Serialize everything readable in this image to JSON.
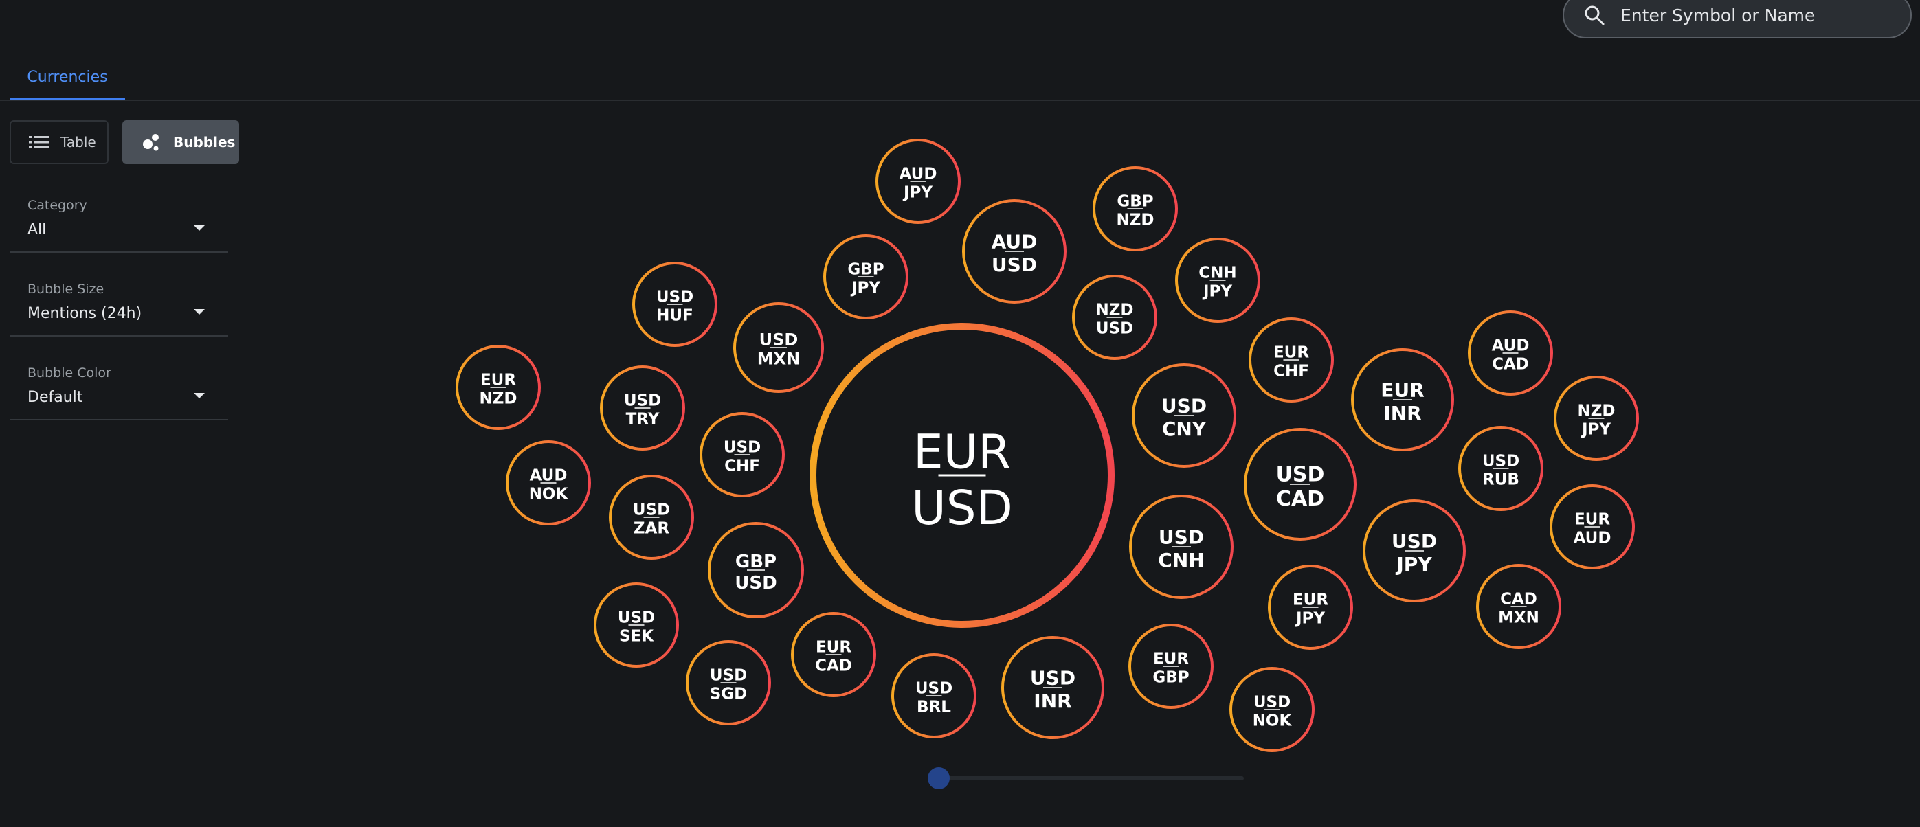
{
  "search": {
    "placeholder": "Enter Symbol or Name"
  },
  "tabs": [
    {
      "label": "Currencies",
      "active": true
    }
  ],
  "view_toggle": {
    "table_label": "Table",
    "bubbles_label": "Bubbles",
    "active": "Bubbles"
  },
  "filters": {
    "category": {
      "label": "Category",
      "value": "All"
    },
    "bubble_size": {
      "label": "Bubble Size",
      "value": "Mentions (24h)"
    },
    "bubble_color": {
      "label": "Bubble Color",
      "value": "Default"
    }
  },
  "colors": {
    "accent": "#4f8ff7",
    "bubble_gradient_start": "#f5a623",
    "bubble_gradient_end": "#f2464e",
    "background": "#16181b"
  },
  "chart_data": {
    "type": "bubble",
    "size_metric": "Mentions (24h)",
    "bubbles": [
      {
        "base": "EUR",
        "quote": "USD"
      },
      {
        "base": "AUD",
        "quote": "JPY"
      },
      {
        "base": "AUD",
        "quote": "USD"
      },
      {
        "base": "GBP",
        "quote": "NZD"
      },
      {
        "base": "GBP",
        "quote": "JPY"
      },
      {
        "base": "CNH",
        "quote": "JPY"
      },
      {
        "base": "NZD",
        "quote": "USD"
      },
      {
        "base": "USD",
        "quote": "HUF"
      },
      {
        "base": "USD",
        "quote": "MXN"
      },
      {
        "base": "EUR",
        "quote": "CHF"
      },
      {
        "base": "AUD",
        "quote": "CAD"
      },
      {
        "base": "EUR",
        "quote": "NZD"
      },
      {
        "base": "USD",
        "quote": "TRY"
      },
      {
        "base": "USD",
        "quote": "CNY"
      },
      {
        "base": "EUR",
        "quote": "INR"
      },
      {
        "base": "NZD",
        "quote": "JPY"
      },
      {
        "base": "USD",
        "quote": "CHF"
      },
      {
        "base": "AUD",
        "quote": "NOK"
      },
      {
        "base": "USD",
        "quote": "RUB"
      },
      {
        "base": "USD",
        "quote": "CAD"
      },
      {
        "base": "USD",
        "quote": "ZAR"
      },
      {
        "base": "EUR",
        "quote": "AUD"
      },
      {
        "base": "USD",
        "quote": "CNH"
      },
      {
        "base": "USD",
        "quote": "JPY"
      },
      {
        "base": "GBP",
        "quote": "USD"
      },
      {
        "base": "CAD",
        "quote": "MXN"
      },
      {
        "base": "EUR",
        "quote": "JPY"
      },
      {
        "base": "USD",
        "quote": "SEK"
      },
      {
        "base": "EUR",
        "quote": "CAD"
      },
      {
        "base": "EUR",
        "quote": "GBP"
      },
      {
        "base": "USD",
        "quote": "SGD"
      },
      {
        "base": "USD",
        "quote": "INR"
      },
      {
        "base": "USD",
        "quote": "BRL"
      },
      {
        "base": "USD",
        "quote": "NOK"
      }
    ]
  }
}
